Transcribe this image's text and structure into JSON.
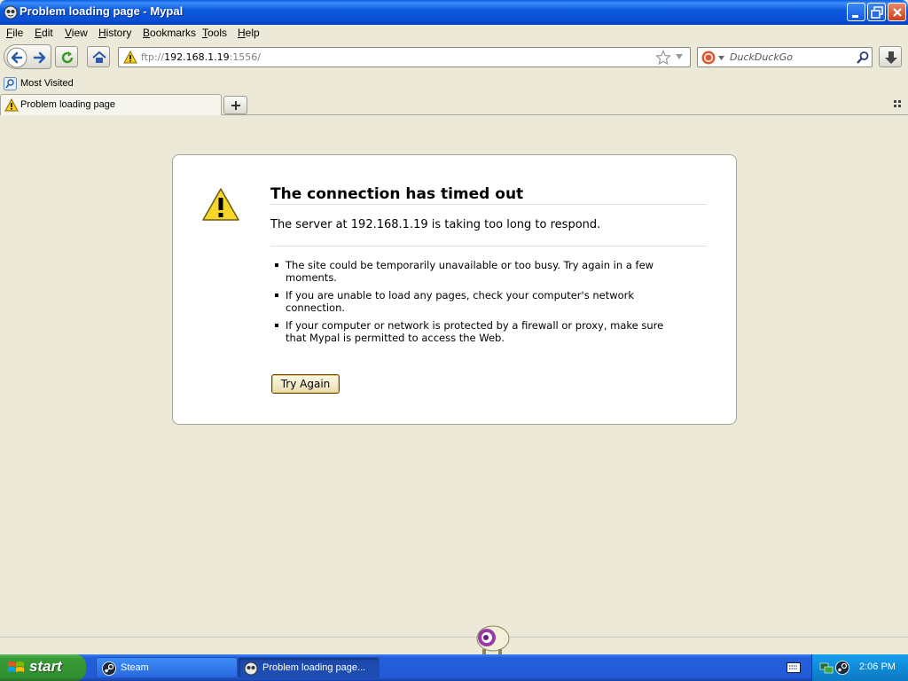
{
  "window": {
    "title": "Problem loading page - Mypal",
    "icon": "mypal-icon"
  },
  "menu": {
    "items": [
      "File",
      "Edit",
      "View",
      "History",
      "Bookmarks",
      "Tools",
      "Help"
    ]
  },
  "navbar": {
    "url_scheme": "ftp://",
    "url_host": "192.168.1.19",
    "url_port": ":1556/",
    "search_placeholder": "DuckDuckGo"
  },
  "bookmarks": {
    "item": "Most Visited"
  },
  "tabs": [
    {
      "label": "Problem loading page",
      "icon": "warning-icon"
    }
  ],
  "error": {
    "title": "The connection has timed out",
    "description": "The server at 192.168.1.19 is taking too long to respond.",
    "bullets": [
      "The site could be temporarily unavailable or too busy. Try again in a few moments.",
      "If you are unable to load any pages, check your computer's network connection.",
      "If your computer or network is protected by a firewall or proxy, make sure that Mypal is permitted to access the Web."
    ],
    "button": "Try Again"
  },
  "taskbar": {
    "start_label": "start",
    "tasks": [
      {
        "label": "Steam",
        "icon": "steam-icon",
        "active": false
      },
      {
        "label": "Problem loading page...",
        "icon": "mypal-icon",
        "active": true
      }
    ],
    "clock": "2:06 PM"
  }
}
